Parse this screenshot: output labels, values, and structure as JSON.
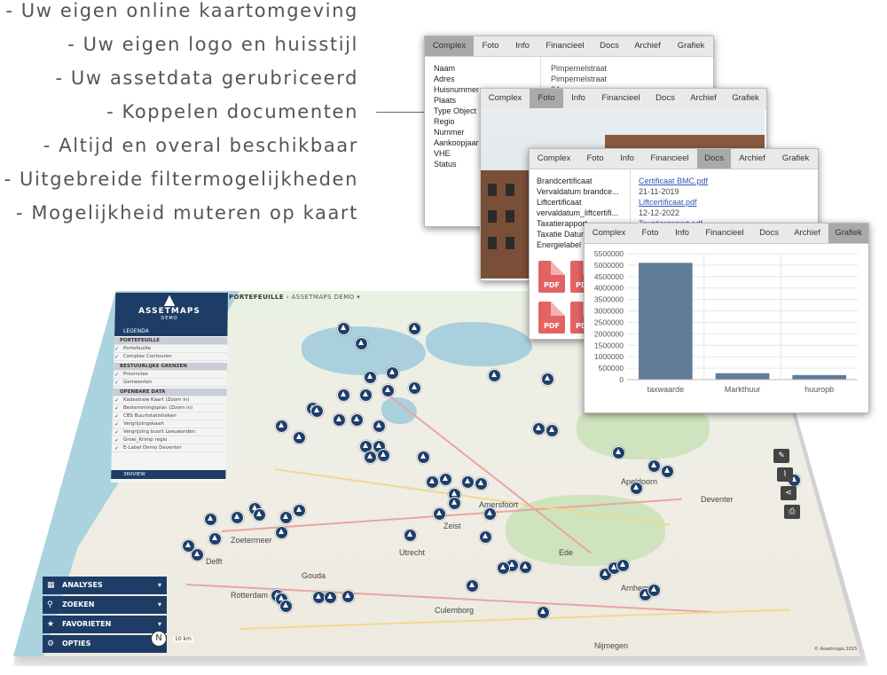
{
  "features": [
    "- Uw eigen online kaartomgeving",
    "- Uw eigen logo en huisstijl",
    "- Uw assetdata gerubriceerd",
    "- Koppelen documenten",
    "- Altijd en overal beschikbaar",
    "- Uitgebreide filtermogelijkheden",
    "- Mogelijkheid muteren op kaart"
  ],
  "tabs": [
    "Complex",
    "Foto",
    "Info",
    "Financieel",
    "Docs",
    "Archief",
    "Grafiek"
  ],
  "complex_panel": {
    "labels": [
      "Naam",
      "Adres",
      "Huisnummer",
      "Plaats",
      "Type Object",
      "Regio",
      "Nummer",
      "Aankoopjaar",
      "VHE",
      "Status"
    ],
    "values": [
      "Pimpernelstraat",
      "Pimpernelstraat",
      "84"
    ]
  },
  "docs_panel": {
    "labels": [
      "Brandcertificaat",
      "Vervaldatum brandce...",
      "Liftcertificaat",
      "vervaldatum_liftcertifi...",
      "Taxatierapport",
      "Taxatie Datum",
      "Energielabel"
    ],
    "values": [
      {
        "text": "Certificaat BMC.pdf",
        "link": true
      },
      {
        "text": "21-11-2019",
        "link": false
      },
      {
        "text": "Liftcertificaat.pdf",
        "link": true
      },
      {
        "text": "12-12-2022",
        "link": false
      },
      {
        "text": "Taxatierapport.pdf",
        "link": true
      }
    ],
    "pdf_label": "PDF"
  },
  "chart_data": {
    "type": "bar",
    "categories": [
      "taxwaarde",
      "Markthuur",
      "huuropb"
    ],
    "values": [
      5100000,
      280000,
      200000
    ],
    "ylim": [
      0,
      5500000
    ],
    "yticks": [
      0,
      500000,
      1000000,
      1500000,
      2000000,
      2500000,
      3000000,
      3500000,
      4000000,
      4500000,
      5000000,
      5500000
    ],
    "title": "",
    "xlabel": "",
    "ylabel": "",
    "bar_color": "#617c99",
    "grid": true
  },
  "map": {
    "breadcrumb": [
      "PORTEFEUILLE",
      "ASSETMAPS DEMO"
    ],
    "logo_title": "ASSETMAPS",
    "logo_subtitle": "DEMO",
    "legenda": "LEGENDA",
    "sections": [
      {
        "title": "PORTEFEUILLE",
        "items": [
          "Portefeuille",
          "Complex Contouren"
        ]
      },
      {
        "title": "BESTUURLIJKE GRENZEN",
        "items": [
          "Provincies",
          "Gemeenten"
        ]
      },
      {
        "title": "OPENBARE DATA",
        "items": [
          "Kadastrale Kaart (Zoom in)",
          "Bestemmingsplan (Zoom in)",
          "CBS Buurtstatistieken",
          "Vergrijzingskaart",
          "Vergrijzing buurt Leeuwarden",
          "Groei_Krimp regio",
          "E-Label Demo Deventer"
        ]
      }
    ],
    "view360": "360VIEW",
    "menu": [
      {
        "label": "ANALYSES",
        "icon": "calculator-icon"
      },
      {
        "label": "ZOEKEN",
        "icon": "search-icon"
      },
      {
        "label": "FAVORIETEN",
        "icon": "star-icon"
      },
      {
        "label": "OPTIES",
        "icon": "gear-icon"
      }
    ],
    "scale_label": "10 km",
    "copyright": "© Assetmaps 2015",
    "cities": [
      "Zoetermeer",
      "Delft",
      "Rotterdam",
      "Amersfoort",
      "Arnhem",
      "Nijmegen",
      "Apeldoorn",
      "Deventer",
      "Utrecht",
      "Gouda",
      "Culemborg",
      "Ede",
      "Zeist"
    ]
  },
  "colors": {
    "navy": "#1d3d66",
    "tab_active": "#a9a9a9",
    "link": "#3355bb",
    "pdf": "#e36363"
  }
}
